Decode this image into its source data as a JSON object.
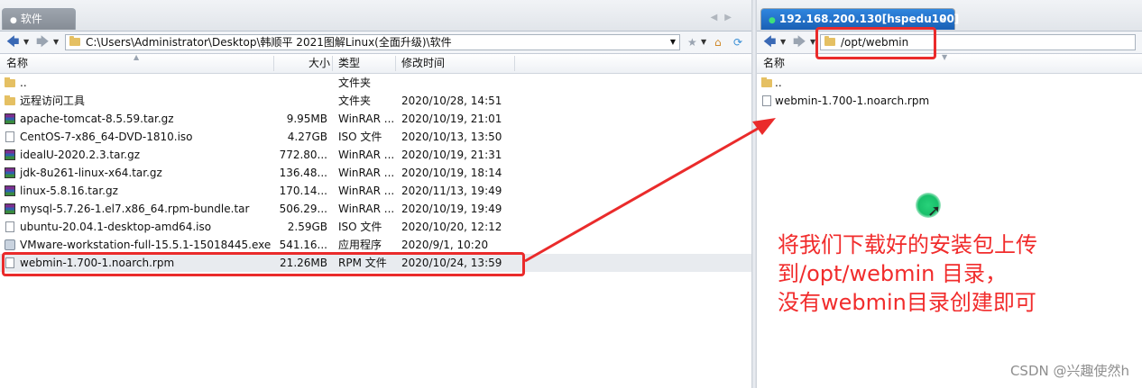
{
  "left": {
    "tab": {
      "label": "软件"
    },
    "path": "C:\\Users\\Administrator\\Desktop\\韩顺平 2021图解Linux(全面升级)\\软件",
    "columns": {
      "name": "名称",
      "size": "大小",
      "type": "类型",
      "modified": "修改时间"
    },
    "files": [
      {
        "icon": "folder-icon",
        "name": "..",
        "size": "",
        "type": "文件夹",
        "modified": ""
      },
      {
        "icon": "folder-icon",
        "name": "远程访问工具",
        "size": "",
        "type": "文件夹",
        "modified": "2020/10/28, 14:51"
      },
      {
        "icon": "rar-archive-icon",
        "name": "apache-tomcat-8.5.59.tar.gz",
        "size": "9.95MB",
        "type": "WinRAR ...",
        "modified": "2020/10/19, 21:01"
      },
      {
        "icon": "file-icon",
        "name": "CentOS-7-x86_64-DVD-1810.iso",
        "size": "4.27GB",
        "type": "ISO 文件",
        "modified": "2020/10/13, 13:50"
      },
      {
        "icon": "rar-archive-icon",
        "name": "idealU-2020.2.3.tar.gz",
        "size": "772.80...",
        "type": "WinRAR ...",
        "modified": "2020/10/19, 21:31"
      },
      {
        "icon": "rar-archive-icon",
        "name": "jdk-8u261-linux-x64.tar.gz",
        "size": "136.48...",
        "type": "WinRAR ...",
        "modified": "2020/10/19, 18:14"
      },
      {
        "icon": "rar-archive-icon",
        "name": "linux-5.8.16.tar.gz",
        "size": "170.14...",
        "type": "WinRAR ...",
        "modified": "2020/11/13, 19:49"
      },
      {
        "icon": "rar-archive-icon",
        "name": "mysql-5.7.26-1.el7.x86_64.rpm-bundle.tar",
        "size": "506.29...",
        "type": "WinRAR ...",
        "modified": "2020/10/19, 19:49"
      },
      {
        "icon": "file-icon",
        "name": "ubuntu-20.04.1-desktop-amd64.iso",
        "size": "2.59GB",
        "type": "ISO 文件",
        "modified": "2020/10/20, 12:12"
      },
      {
        "icon": "exe-icon",
        "name": "VMware-workstation-full-15.5.1-15018445.exe",
        "size": "541.16...",
        "type": "应用程序",
        "modified": "2020/9/1, 10:20"
      },
      {
        "icon": "file-icon",
        "name": "webmin-1.700-1.noarch.rpm",
        "size": "21.26MB",
        "type": "RPM 文件",
        "modified": "2020/10/24, 13:59",
        "selected": true
      }
    ]
  },
  "right": {
    "tab": {
      "label": "192.168.200.130[hspedu100]",
      "close": "×"
    },
    "path": "/opt/webmin",
    "columns": {
      "name": "名称"
    },
    "files": [
      {
        "icon": "folder-icon",
        "name": ".."
      },
      {
        "icon": "file-icon",
        "name": "webmin-1.700-1.noarch.rpm"
      }
    ]
  },
  "annotation": {
    "lines": [
      "将我们下载好的安装包上传",
      "到/opt/webmin 目录，",
      "没有webmin目录创建即可"
    ],
    "color": "#f12c2c"
  },
  "watermark": "CSDN @兴趣使然h"
}
